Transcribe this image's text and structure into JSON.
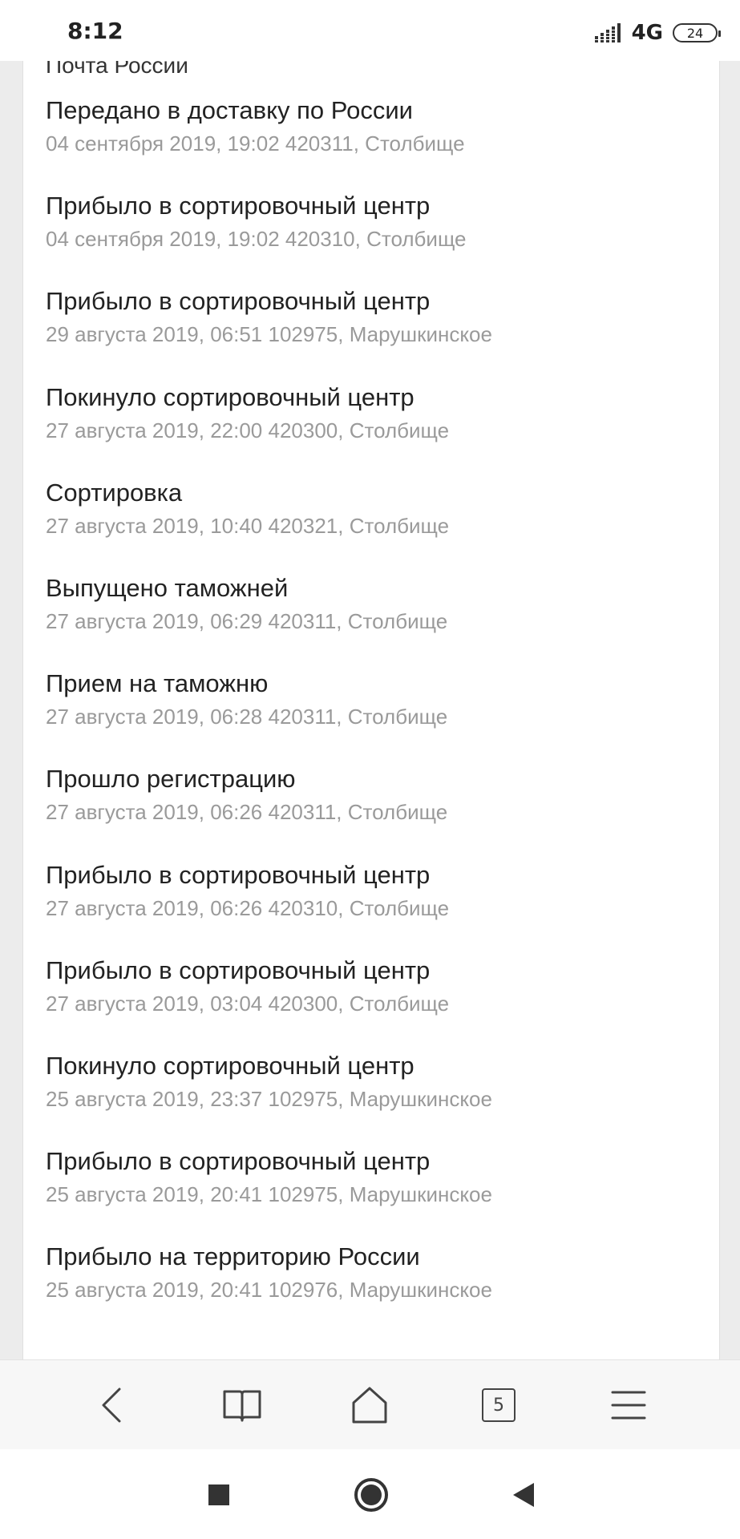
{
  "status_bar": {
    "time": "8:12",
    "network": "4G",
    "battery": "24",
    "icons": [
      "signal-icon",
      "battery-icon"
    ]
  },
  "page": {
    "carrier": "Почта России",
    "events": [
      {
        "title": "Передано в доставку по России",
        "details": "04 сентября 2019, 19:02 420311, Столбище"
      },
      {
        "title": "Прибыло в сортировочный центр",
        "details": "04 сентября 2019, 19:02 420310, Столбище"
      },
      {
        "title": "Прибыло в сортировочный центр",
        "details": "29 августа 2019, 06:51 102975, Марушкинское"
      },
      {
        "title": "Покинуло сортировочный центр",
        "details": "27 августа 2019, 22:00 420300, Столбище"
      },
      {
        "title": "Сортировка",
        "details": "27 августа 2019, 10:40 420321, Столбище"
      },
      {
        "title": "Выпущено таможней",
        "details": "27 августа 2019, 06:29 420311, Столбище"
      },
      {
        "title": "Прием на таможню",
        "details": "27 августа 2019, 06:28 420311, Столбище"
      },
      {
        "title": "Прошло регистрацию",
        "details": "27 августа 2019, 06:26 420311, Столбище"
      },
      {
        "title": "Прибыло в сортировочный центр",
        "details": "27 августа 2019, 06:26 420310, Столбище"
      },
      {
        "title": "Прибыло в сортировочный центр",
        "details": "27 августа 2019, 03:04 420300, Столбище"
      },
      {
        "title": "Покинуло сортировочный центр",
        "details": "25 августа 2019, 23:37 102975, Марушкинское"
      },
      {
        "title": "Прибыло в сортировочный центр",
        "details": "25 августа 2019, 20:41 102975, Марушкинское"
      },
      {
        "title": "Прибыло на территорию России",
        "details": "25 августа 2019, 20:41 102976, Марушкинское"
      }
    ]
  },
  "browser_toolbar": {
    "tabs_count": "5",
    "icons": [
      "back-arrow-icon",
      "bookmarks-book-icon",
      "home-icon",
      "tabs-counter-icon",
      "menu-icon"
    ]
  },
  "system_nav": {
    "icons": [
      "recent-apps-square-icon",
      "home-circle-icon",
      "back-triangle-icon"
    ]
  },
  "colors": {
    "title_text": "#222222",
    "detail_text": "#9a9a9a",
    "background": "#ececec",
    "card": "#ffffff"
  }
}
